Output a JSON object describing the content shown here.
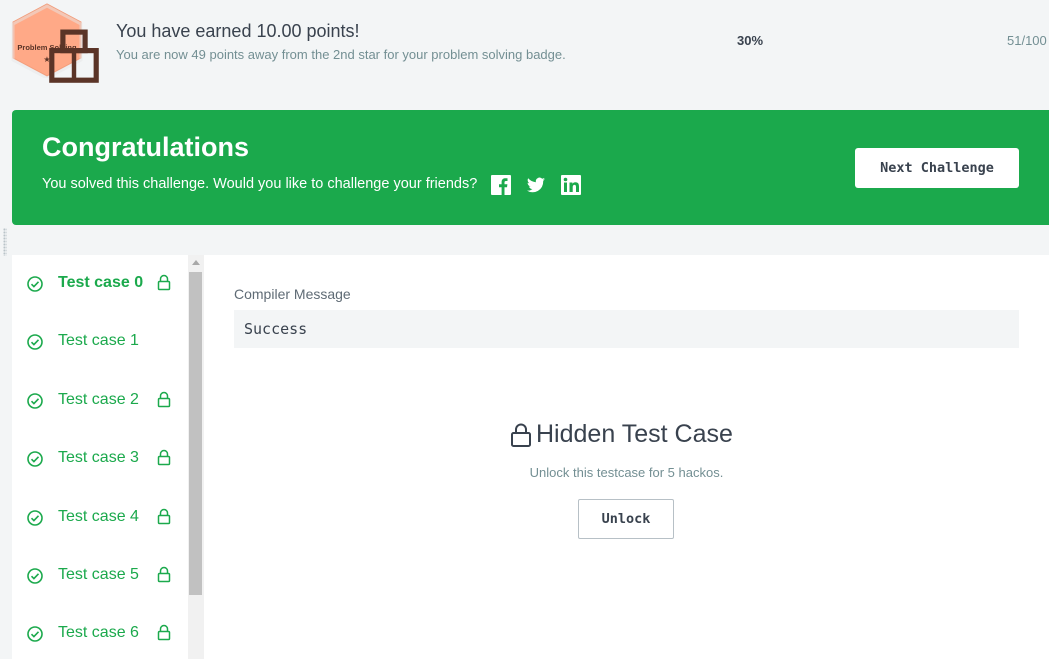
{
  "points_bar": {
    "badge_label": "Problem Solving",
    "badge_stars": "★",
    "title": "You have earned 10.00 points!",
    "subtitle": "You are now 49 points away from the 2nd star for your problem solving badge.",
    "progress_percent": "30%",
    "progress_count": "51/100",
    "badge_color": "#ffa987"
  },
  "banner": {
    "title": "Congratulations",
    "message": "You solved this challenge. Would you like to challenge your friends?",
    "social_icons": [
      "facebook-icon",
      "twitter-icon",
      "linkedin-icon"
    ],
    "next_button": "Next Challenge",
    "color": "#1ba94c"
  },
  "test_cases": [
    {
      "label": "Test case 0",
      "passed": true,
      "locked": true,
      "active": true
    },
    {
      "label": "Test case 1",
      "passed": true,
      "locked": false,
      "active": false
    },
    {
      "label": "Test case 2",
      "passed": true,
      "locked": true,
      "active": false
    },
    {
      "label": "Test case 3",
      "passed": true,
      "locked": true,
      "active": false
    },
    {
      "label": "Test case 4",
      "passed": true,
      "locked": true,
      "active": false
    },
    {
      "label": "Test case 5",
      "passed": true,
      "locked": true,
      "active": false
    },
    {
      "label": "Test case 6",
      "passed": true,
      "locked": true,
      "active": false
    }
  ],
  "detail": {
    "compiler_label": "Compiler Message",
    "compiler_value": "Success",
    "hidden_title": "Hidden Test Case",
    "hidden_subtitle": "Unlock this testcase for 5 hackos.",
    "unlock_button": "Unlock"
  }
}
